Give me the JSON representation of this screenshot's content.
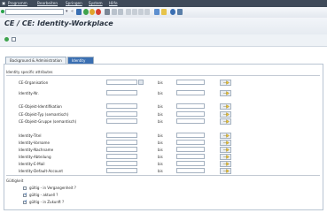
{
  "menu": [
    "Programm",
    "Bearbeiten",
    "Springen",
    "System",
    "Hilfe"
  ],
  "title": "CE / CE: Identity-Workplace",
  "tabs": [
    {
      "label": "Background & Administration",
      "selected": false
    },
    {
      "label": "Identity",
      "selected": true
    }
  ],
  "identity_group": {
    "title": "Identity specific attributes",
    "bis_label": "bis",
    "fields": [
      {
        "label": "CE-Organisation",
        "value": "",
        "to_value": ""
      },
      {
        "label": "Identity-Nr.",
        "value": "",
        "to_value": ""
      },
      {
        "label": "CE-Objekt-Identifikation",
        "value": "",
        "to_value": ""
      },
      {
        "label": "CE-Objekt-Typ (semantisch)",
        "value": "",
        "to_value": ""
      },
      {
        "label": "CE-Objekt-Gruppe (semantisch)",
        "value": "",
        "to_value": ""
      },
      {
        "label": "Identity-Titel",
        "value": "",
        "to_value": ""
      },
      {
        "label": "Identity-Vorname",
        "value": "",
        "to_value": ""
      },
      {
        "label": "Identity-Nachname",
        "value": "",
        "to_value": ""
      },
      {
        "label": "Identity-Abteilung",
        "value": "",
        "to_value": ""
      },
      {
        "label": "Identity-E-Mail",
        "value": "",
        "to_value": ""
      },
      {
        "label": "Identity-Default-Account",
        "value": "",
        "to_value": ""
      }
    ]
  },
  "validity_group": {
    "title": "Gültigkeit",
    "options": [
      {
        "label": "gültig - in Vergangenheit ?",
        "checked": false
      },
      {
        "label": "gültig - aktuell ?",
        "checked": true
      },
      {
        "label": "gültig - in Zukunft ?",
        "checked": true
      }
    ]
  },
  "colors": {
    "menubar": "#3f4a59",
    "selected_tab": "#3a6fb2",
    "accent": "#2b6fc5"
  }
}
